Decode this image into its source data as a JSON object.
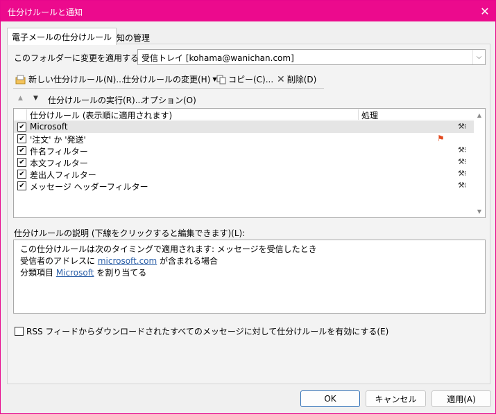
{
  "window": {
    "title": "仕分けルールと通知",
    "accent": "#ec0a8d"
  },
  "tabs": [
    {
      "label": "電子メールの仕分けルール",
      "active": true
    },
    {
      "label": "通知の管理",
      "active": false
    }
  ],
  "folder": {
    "label": "このフォルダーに変更を適用する(F):",
    "value": "受信トレイ [kohama@wanichan.com]"
  },
  "toolbar": {
    "new_rule": "新しい仕分けルール(N)...",
    "change_rule": "仕分けルールの変更(H)",
    "copy": "コピー(C)...",
    "delete": "削除(D)"
  },
  "toolbar2": {
    "run_rules": "仕分けルールの実行(R)...",
    "options": "オプション(O)"
  },
  "rules_list": {
    "col_rule": "仕分けルール (表示順に適用されます)",
    "col_action": "処理",
    "rows": [
      {
        "name": "Microsoft",
        "checked": true,
        "selected": true,
        "icon": "rule-action-icon"
      },
      {
        "name": "'注文' か '発送'",
        "checked": true,
        "selected": false,
        "icon": "flag-icon"
      },
      {
        "name": "件名フィルター",
        "checked": true,
        "selected": false,
        "icon": "rule-action-icon"
      },
      {
        "name": "本文フィルター",
        "checked": true,
        "selected": false,
        "icon": "rule-action-icon"
      },
      {
        "name": "差出人フィルター",
        "checked": true,
        "selected": false,
        "icon": "rule-action-icon"
      },
      {
        "name": "メッセージ ヘッダーフィルター",
        "checked": true,
        "selected": false,
        "icon": "rule-action-icon"
      }
    ]
  },
  "description": {
    "label": "仕分けルールの説明 (下線をクリックすると編集できます)(L):",
    "line1": "この仕分けルールは次のタイミングで適用されます: メッセージを受信したとき",
    "line2_pre": "受信者のアドレスに ",
    "line2_link": "microsoft.com",
    "line2_post": " が含まれる場合",
    "line3_pre": "分類項目 ",
    "line3_link": "Microsoft",
    "line3_post": " を割り当てる"
  },
  "rss": {
    "label": "RSS フィードからダウンロードされたすべてのメッセージに対して仕分けルールを有効にする(E)",
    "checked": false
  },
  "buttons": {
    "ok": "OK",
    "cancel": "キャンセル",
    "apply": "適用(A)"
  }
}
